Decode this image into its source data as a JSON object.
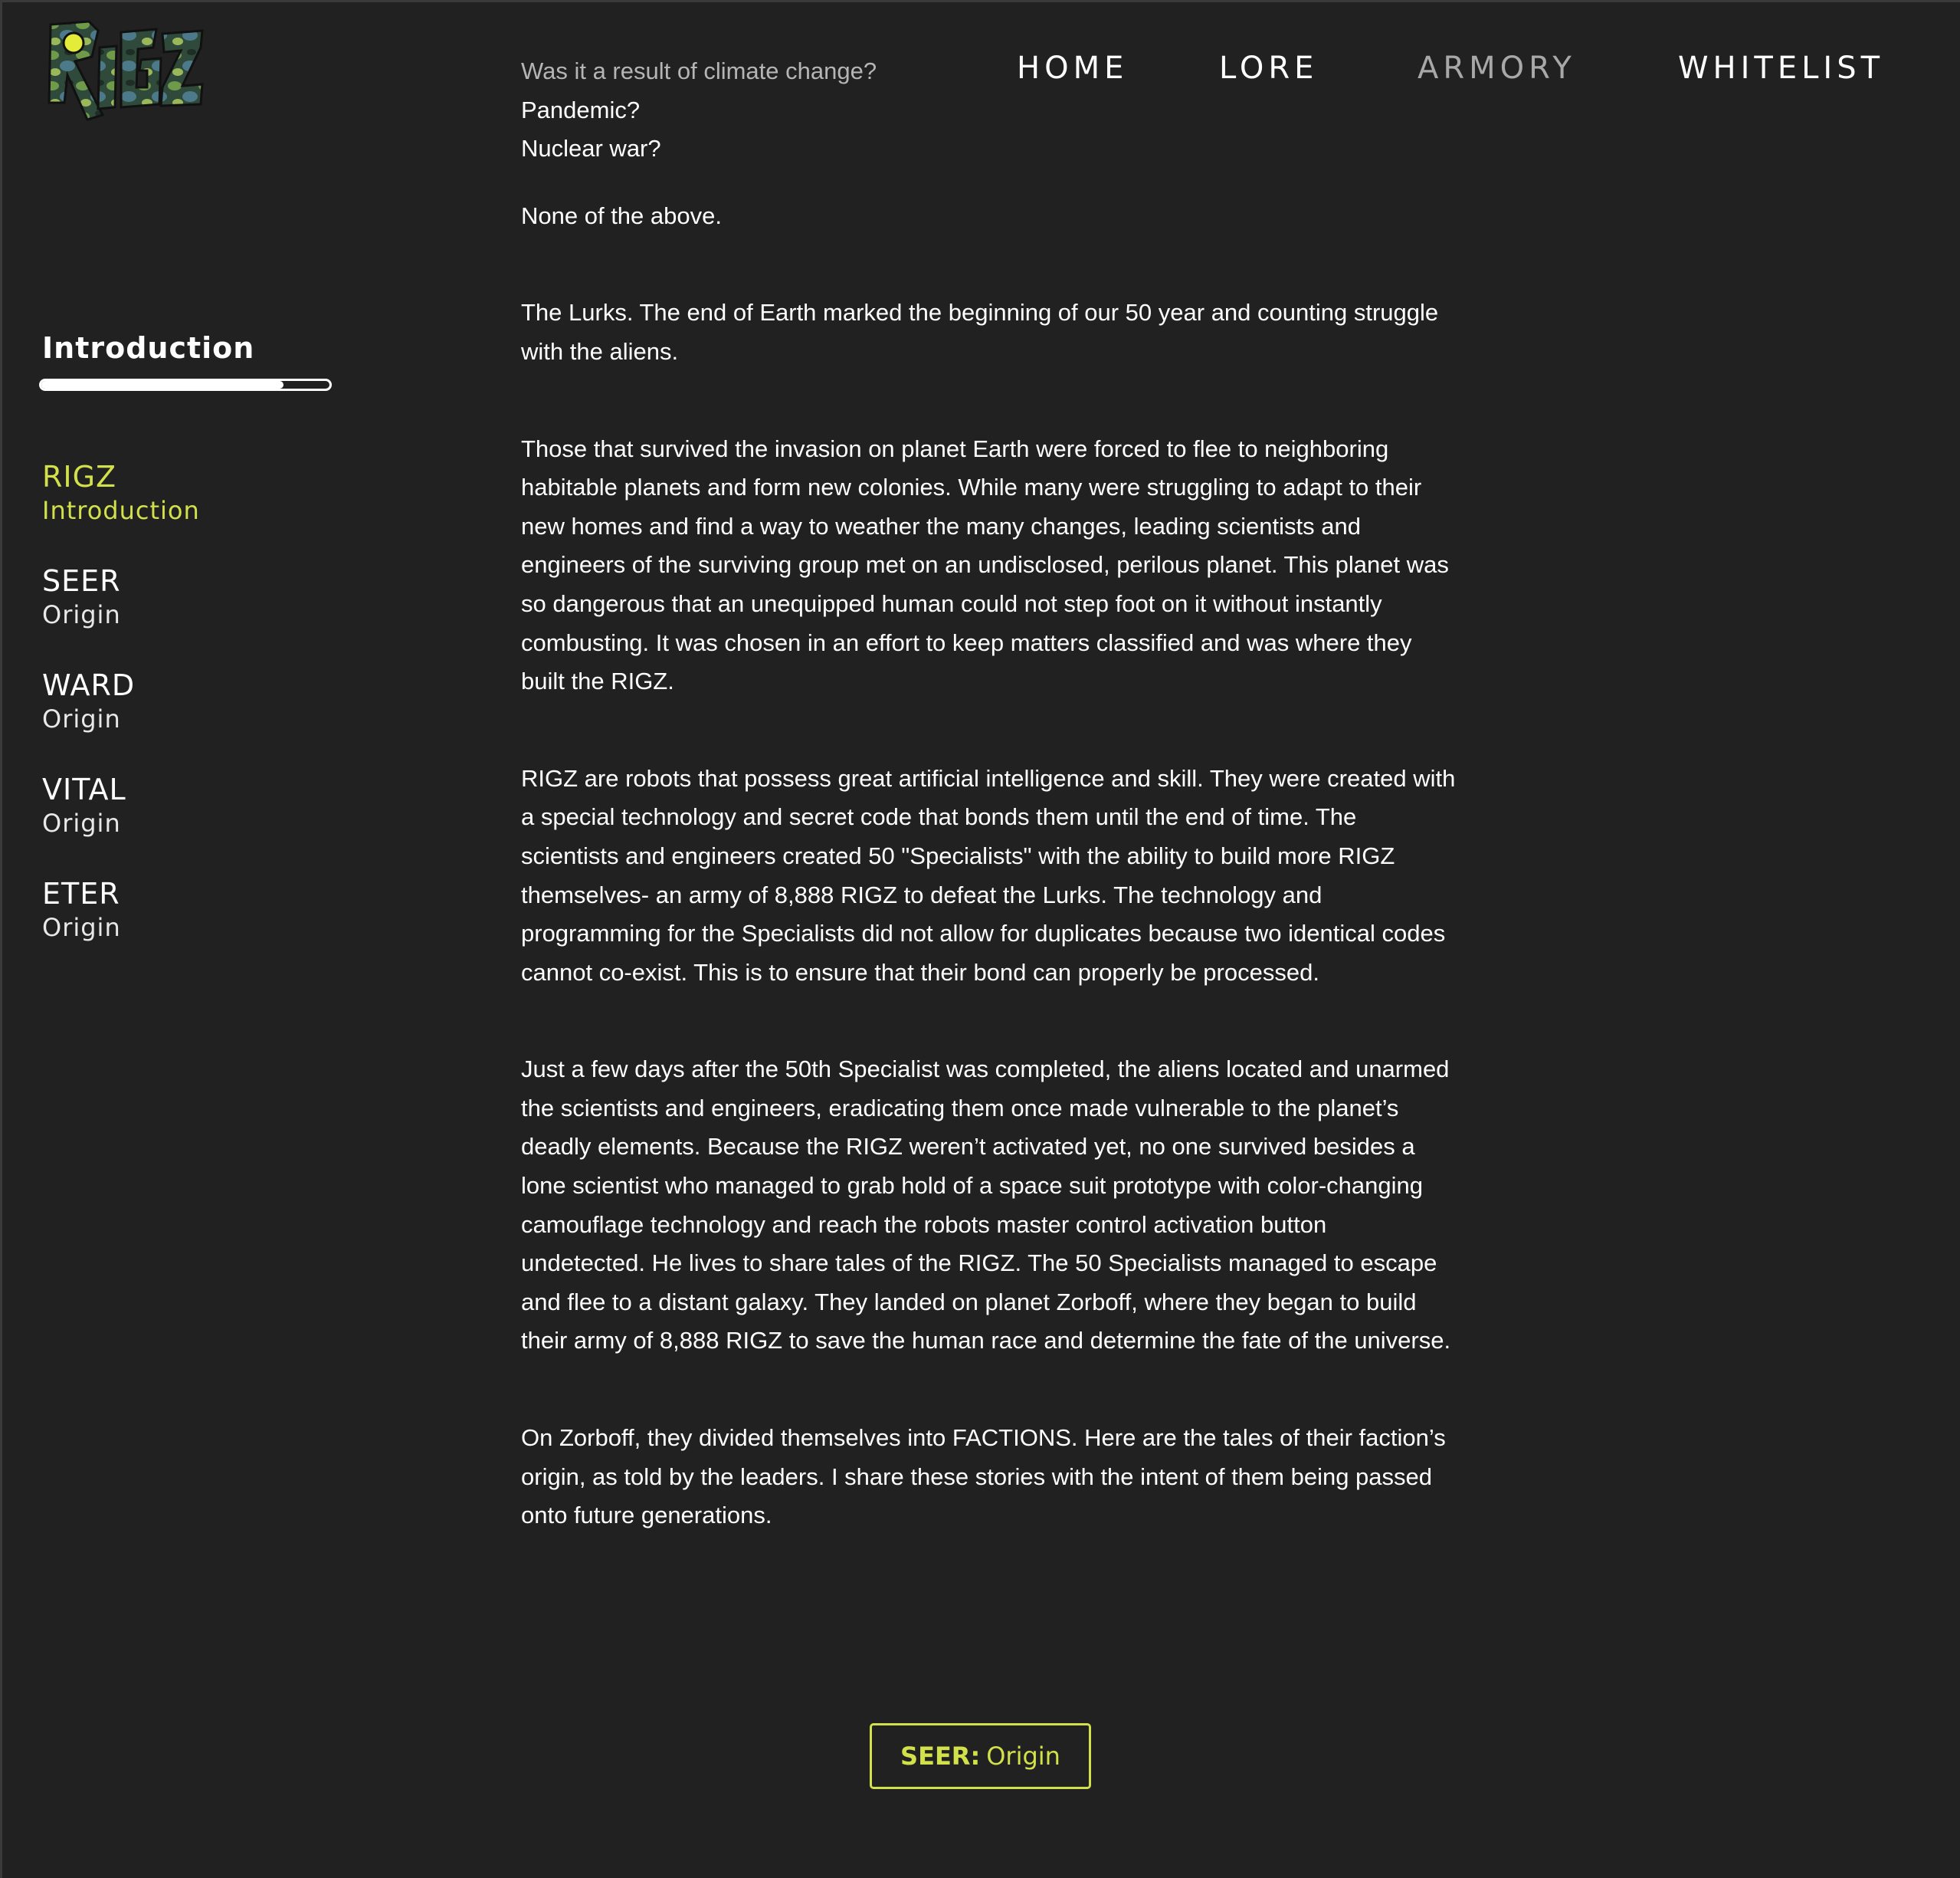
{
  "brand": {
    "logo_text": "RIGZ",
    "accent_color": "#d2e04a",
    "background_color": "#212121"
  },
  "nav": {
    "items": [
      "HOME",
      "LORE",
      "ARMORY",
      "WHITELIST"
    ]
  },
  "sidebar": {
    "heading": "Introduction",
    "progress": 0.84,
    "items": [
      {
        "title": "RIGZ",
        "subtitle": "Introduction",
        "active": true
      },
      {
        "title": "SEER",
        "subtitle": "Origin",
        "active": false
      },
      {
        "title": "WARD",
        "subtitle": "Origin",
        "active": false
      },
      {
        "title": "VITAL",
        "subtitle": "Origin",
        "active": false
      },
      {
        "title": "ETER",
        "subtitle": "Origin",
        "active": false
      }
    ]
  },
  "content": {
    "questions": [
      "Was it a result of climate change?",
      "Pandemic?",
      "Nuclear war?"
    ],
    "answer": "None of the above.",
    "paragraphs": [
      "The Lurks. The end of Earth marked the beginning of our 50 year and counting struggle with the aliens.",
      "Those that survived the invasion on planet Earth were forced to flee to neighboring habitable planets and form new colonies. While many were struggling to adapt to their new homes and find a way to weather the many changes, leading scientists and engineers of the surviving group met on an undisclosed, perilous planet. This planet was so dangerous that an unequipped human could not step foot on it without instantly combusting. It was chosen in an effort to keep matters classified and was where they built the RIGZ.",
      "RIGZ are robots that possess great artificial intelligence and skill. They were created with a special technology and secret code that bonds them until the end of time. The scientists and engineers created 50 \"Specialists\" with the ability to build more RIGZ themselves- an army of 8,888 RIGZ to defeat the Lurks. The technology and programming for the Specialists did not allow for duplicates because two identical codes cannot co-exist. This is to ensure that their bond can properly be processed.",
      "Just a few days after the 50th Specialist was completed, the aliens located and unarmed the scientists and engineers, eradicating them once made vulnerable to the planet’s deadly elements. Because the RIGZ weren’t activated yet, no one survived besides a lone scientist who managed to grab hold of a space suit prototype with color-changing camouflage technology and reach the robots master control activation button undetected. He lives to share tales of the RIGZ. The 50 Specialists managed to escape and flee to a distant galaxy. They landed on planet Zorboff, where they began to build their army of 8,888 RIGZ to save the human race and determine the fate of the universe.",
      "On Zorboff, they divided themselves into FACTIONS. Here are the tales of their faction’s origin, as told by the leaders. I share these stories with the intent of them being passed onto future generations."
    ]
  },
  "next_button": {
    "bold": "SEER:",
    "text": "Origin"
  }
}
